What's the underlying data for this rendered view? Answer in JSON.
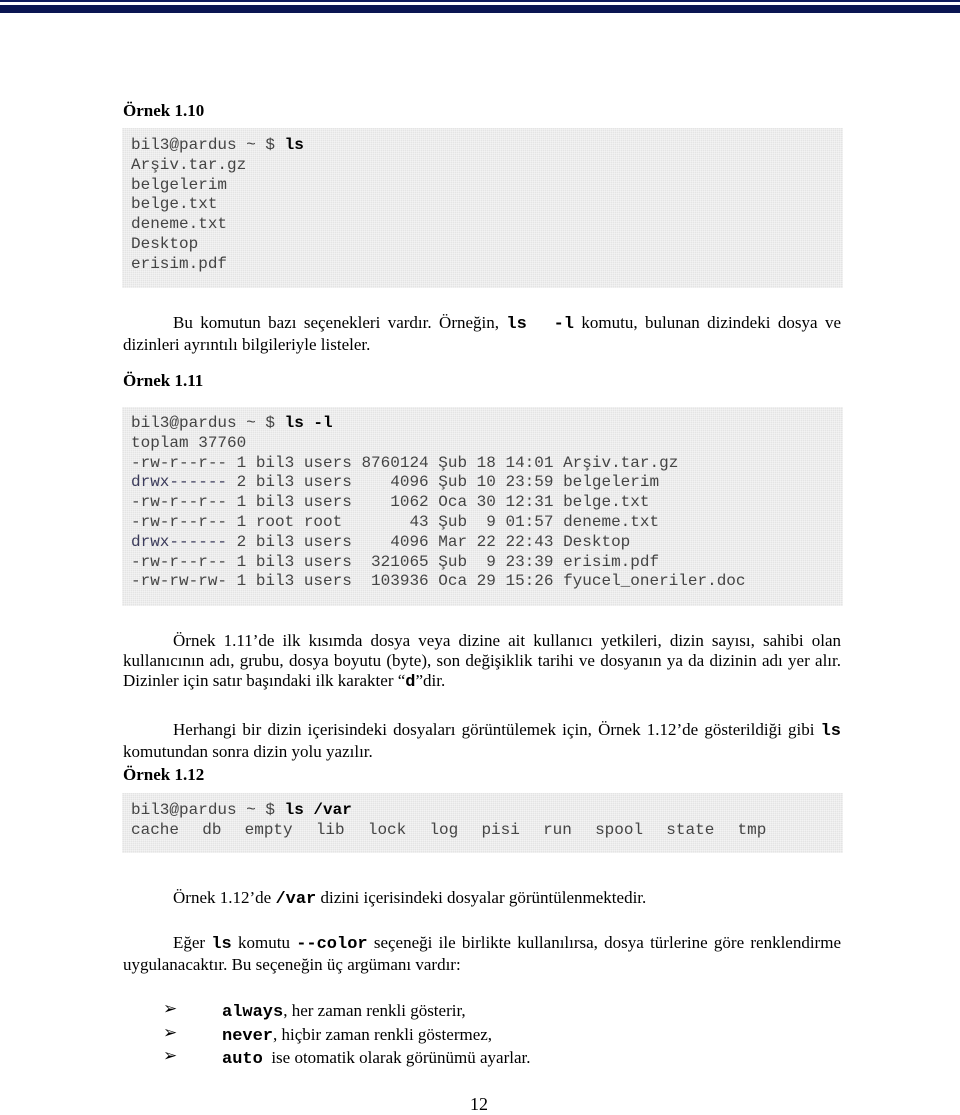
{
  "header_bar": {
    "color": "#0a1652"
  },
  "example_1_10": {
    "title": "Örnek 1.10",
    "prompt": "bil3@pardus ~ $ ",
    "command": "ls",
    "output": [
      "Arşiv.tar.gz",
      "belgelerim",
      "belge.txt",
      "deneme.txt",
      "Desktop",
      "erisim.pdf"
    ]
  },
  "para1": {
    "before": "Bu komutun bazı seçenekleri vardır. Örneğin, ",
    "code": "ls  -l",
    "after": " komutu, bulunan dizindeki dosya ve dizinleri ayrıntılı bilgileriyle listeler."
  },
  "example_1_11": {
    "title": "Örnek 1.11",
    "prompt": "bil3@pardus ~ $ ",
    "command": "ls -l",
    "total": "toplam 37760",
    "rows": [
      {
        "perm": "-rw-r--r--",
        "links": "1",
        "owner": "bil3",
        "group": "users",
        "size": "8760124",
        "month": "Şub",
        "day": "18",
        "time": "14:01",
        "name": "Arşiv.tar.gz"
      },
      {
        "perm": "drwx------",
        "links": "2",
        "owner": "bil3",
        "group": "users",
        "size": "4096",
        "month": "Şub",
        "day": "10",
        "time": "23:59",
        "name": "belgelerim"
      },
      {
        "perm": "-rw-r--r--",
        "links": "1",
        "owner": "bil3",
        "group": "users",
        "size": "1062",
        "month": "Oca",
        "day": "30",
        "time": "12:31",
        "name": "belge.txt"
      },
      {
        "perm": "-rw-r--r--",
        "links": "1",
        "owner": "root",
        "group": "root",
        "size": "43",
        "month": "Şub",
        "day": "9",
        "time": "01:57",
        "name": "deneme.txt"
      },
      {
        "perm": "drwx------",
        "links": "2",
        "owner": "bil3",
        "group": "users",
        "size": "4096",
        "month": "Mar",
        "day": "22",
        "time": "22:43",
        "name": "Desktop"
      },
      {
        "perm": "-rw-r--r--",
        "links": "1",
        "owner": "bil3",
        "group": "users",
        "size": "321065",
        "month": "Şub",
        "day": "9",
        "time": "23:39",
        "name": "erisim.pdf"
      },
      {
        "perm": "-rw-rw-rw-",
        "links": "1",
        "owner": "bil3",
        "group": "users",
        "size": "103936",
        "month": "Oca",
        "day": "29",
        "time": "15:26",
        "name": "fyucel_oneriler.doc"
      }
    ]
  },
  "para2": {
    "before": "Örnek 1.11’de ilk kısımda dosya veya dizine ait kullanıcı yetkileri, dizin sayısı, sahibi olan kullanıcının adı, grubu, dosya boyutu (byte), son değişiklik tarihi ve dosyanın ya da dizinin adı yer alır. Dizinler için satır başındaki ilk karakter “",
    "code": "d",
    "after": "”dir."
  },
  "para3": {
    "before": "Herhangi bir dizin içerisindeki dosyaları görüntülemek için, Örnek 1.12’de gösterildiği gibi ",
    "code": "ls",
    "after": " komutundan sonra dizin yolu yazılır."
  },
  "example_1_12": {
    "title": "Örnek 1.12",
    "prompt": "bil3@pardus ~ $ ",
    "command": "ls /var",
    "output": "cache  db  empty  lib  lock  log  pisi  run  spool  state  tmp"
  },
  "para4": {
    "before": "Örnek 1.12’de ",
    "code": "/var",
    "after": " dizini içerisindeki dosyalar görüntülenmektedir."
  },
  "para5": {
    "before": "Eğer ",
    "code1": "ls",
    "mid": " komutu ",
    "code2": "--color",
    "after": " seçeneği ile birlikte kullanılırsa, dosya türlerine göre renklendirme uygulanacaktır. Bu seçeneğin üç argümanı vardır:"
  },
  "bullets": [
    {
      "icon": "➢",
      "code": "always",
      "text": ", her zaman renkli gösterir,"
    },
    {
      "icon": "➢",
      "code": "never",
      "text": ", hiçbir zaman renkli göstermez,"
    },
    {
      "icon": "➢",
      "code": "auto",
      "text": "  ise otomatik olarak görünümü ayarlar."
    }
  ],
  "page_number": "12"
}
